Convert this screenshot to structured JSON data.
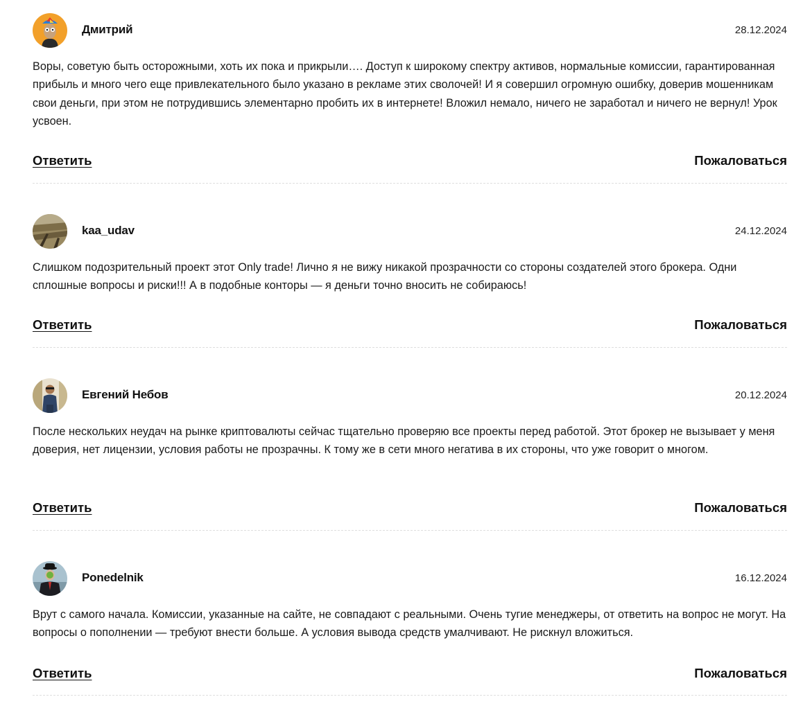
{
  "comments": [
    {
      "author": "Дмитрий",
      "date": "28.12.2024",
      "text": "Воры, советую быть осторожными, хоть их пока и прикрыли…. Доступ к широкому спектру активов, нормальные комиссии, гарантированная прибыль и много чего еще привлекательного было указано в рекламе этих сволочей! И я совершил огромную ошибку, доверив мошенникам свои деньги, при этом не потрудившись элементарно пробить их в интернете! Вложил немало, ничего не заработал и ничего не вернул! Урок усвоен.",
      "reply_label": "Ответить",
      "report_label": "Пожаловаться"
    },
    {
      "author": "kaa_udav",
      "date": "24.12.2024",
      "text": "Слишком подозрительный проект этот Only trade! Лично я не вижу никакой прозрачности со стороны создателей этого брокера. Одни сплошные вопросы и риски!!! А в подобные конторы — я деньги точно вносить не собираюсь!",
      "reply_label": "Ответить",
      "report_label": "Пожаловаться"
    },
    {
      "author": "Евгений Небов",
      "date": "20.12.2024",
      "text": "После нескольких неудач на рынке криптовалюты сейчас тщательно проверяю все проекты перед работой. Этот брокер не вызывает у меня доверия, нет лицензии, условия работы не прозрачны. К тому же в сети много негатива в их стороны, что уже говорит о многом.",
      "reply_label": "Ответить",
      "report_label": "Пожаловаться"
    },
    {
      "author": "Ponedelnik",
      "date": "16.12.2024",
      "text": "Врут с самого начала. Комиссии, указанные на сайте, не совпадают с реальными. Очень тугие менеджеры, от ответить на вопрос не могут. На вопросы о пополнении — требуют внести больше. А условия вывода средств умалчивают. Не рискнул вложиться.",
      "reply_label": "Ответить",
      "report_label": "Пожаловаться"
    }
  ]
}
